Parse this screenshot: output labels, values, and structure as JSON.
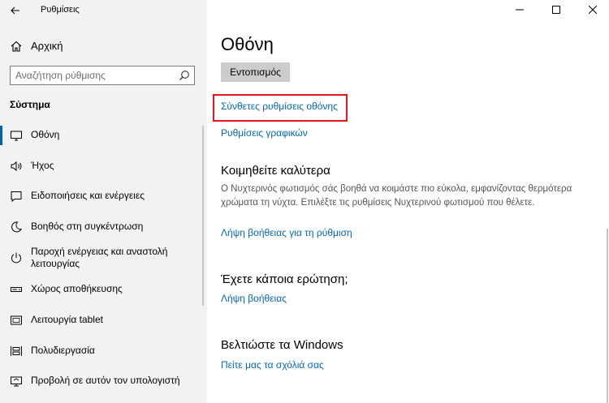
{
  "window": {
    "app_title": "Ρυθμίσεις"
  },
  "sidebar": {
    "home_label": "Αρχική",
    "search_placeholder": "Αναζήτηση ρύθμισης",
    "section_title": "Σύστημα",
    "items": [
      {
        "label": "Οθόνη",
        "icon": "display-icon",
        "active": true
      },
      {
        "label": "Ήχος",
        "icon": "speaker-icon"
      },
      {
        "label": "Ειδοποιήσεις και ενέργειες",
        "icon": "notification-icon"
      },
      {
        "label": "Βοηθός στη συγκέντρωση",
        "icon": "moon-icon"
      },
      {
        "label": "Παροχή ενέργειας και αναστολή λειτουργίας",
        "icon": "power-icon"
      },
      {
        "label": "Χώρος αποθήκευσης",
        "icon": "storage-icon"
      },
      {
        "label": "Λειτουργία tablet",
        "icon": "tablet-icon"
      },
      {
        "label": "Πολυδιεργασία",
        "icon": "multitasking-icon"
      },
      {
        "label": "Προβολή σε αυτόν τον υπολογιστή",
        "icon": "projecting-icon"
      }
    ]
  },
  "main": {
    "title": "Οθόνη",
    "detect_button": "Εντοπισμός",
    "advanced_link": "Σύνθετες ρυθμίσεις οθόνης",
    "graphics_link": "Ρυθμίσεις γραφικών",
    "sleep_heading": "Κοιμηθείτε καλύτερα",
    "sleep_text": "Ο Νυχτερινός φωτισμός σάς βοηθά να κοιμάστε πιο εύκολα, εμφανίζοντας θερμότερα χρώματα τη νύχτα. Επιλέξτε τις ρυθμίσεις Νυχτερινού φωτισμού που θέλετε.",
    "sleep_link": "Λήψη βοήθειας για τη ρύθμιση",
    "question_heading": "Έχετε κάποια ερώτηση;",
    "question_link": "Λήψη βοήθειας",
    "improve_heading": "Βελτιώστε τα Windows",
    "improve_link": "Πείτε μας τα σχόλιά σας"
  },
  "colors": {
    "accent": "#0063b1",
    "link": "#0067c0",
    "highlight": "#e8141d"
  }
}
